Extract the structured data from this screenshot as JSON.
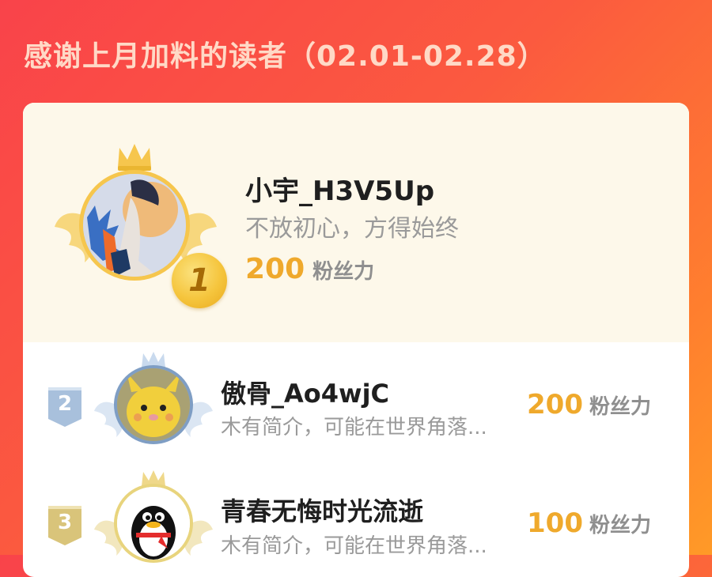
{
  "header": {
    "title": "感谢上月加料的读者（02.01-02.28）"
  },
  "leaderboard": [
    {
      "rank": "1",
      "name": "小宇_H3V5Up",
      "bio": "不放初心，方得始终",
      "score": "200",
      "unit": "粉丝力"
    },
    {
      "rank": "2",
      "name": "傲骨_Ao4wjC",
      "bio": "木有简介，可能在世界角落...",
      "score": "200",
      "unit": "粉丝力"
    },
    {
      "rank": "3",
      "name": "青春无悔时光流逝",
      "bio": "木有简介，可能在世界角落...",
      "score": "100",
      "unit": "粉丝力"
    }
  ],
  "colors": {
    "gold": "#f6c64d",
    "silver": "#7f9ec4",
    "bronze": "#e8d47d",
    "score": "#efa92c"
  },
  "icons": [
    "crown-icon",
    "wings-icon",
    "rank-badge-icon",
    "qq-penguin-icon"
  ]
}
